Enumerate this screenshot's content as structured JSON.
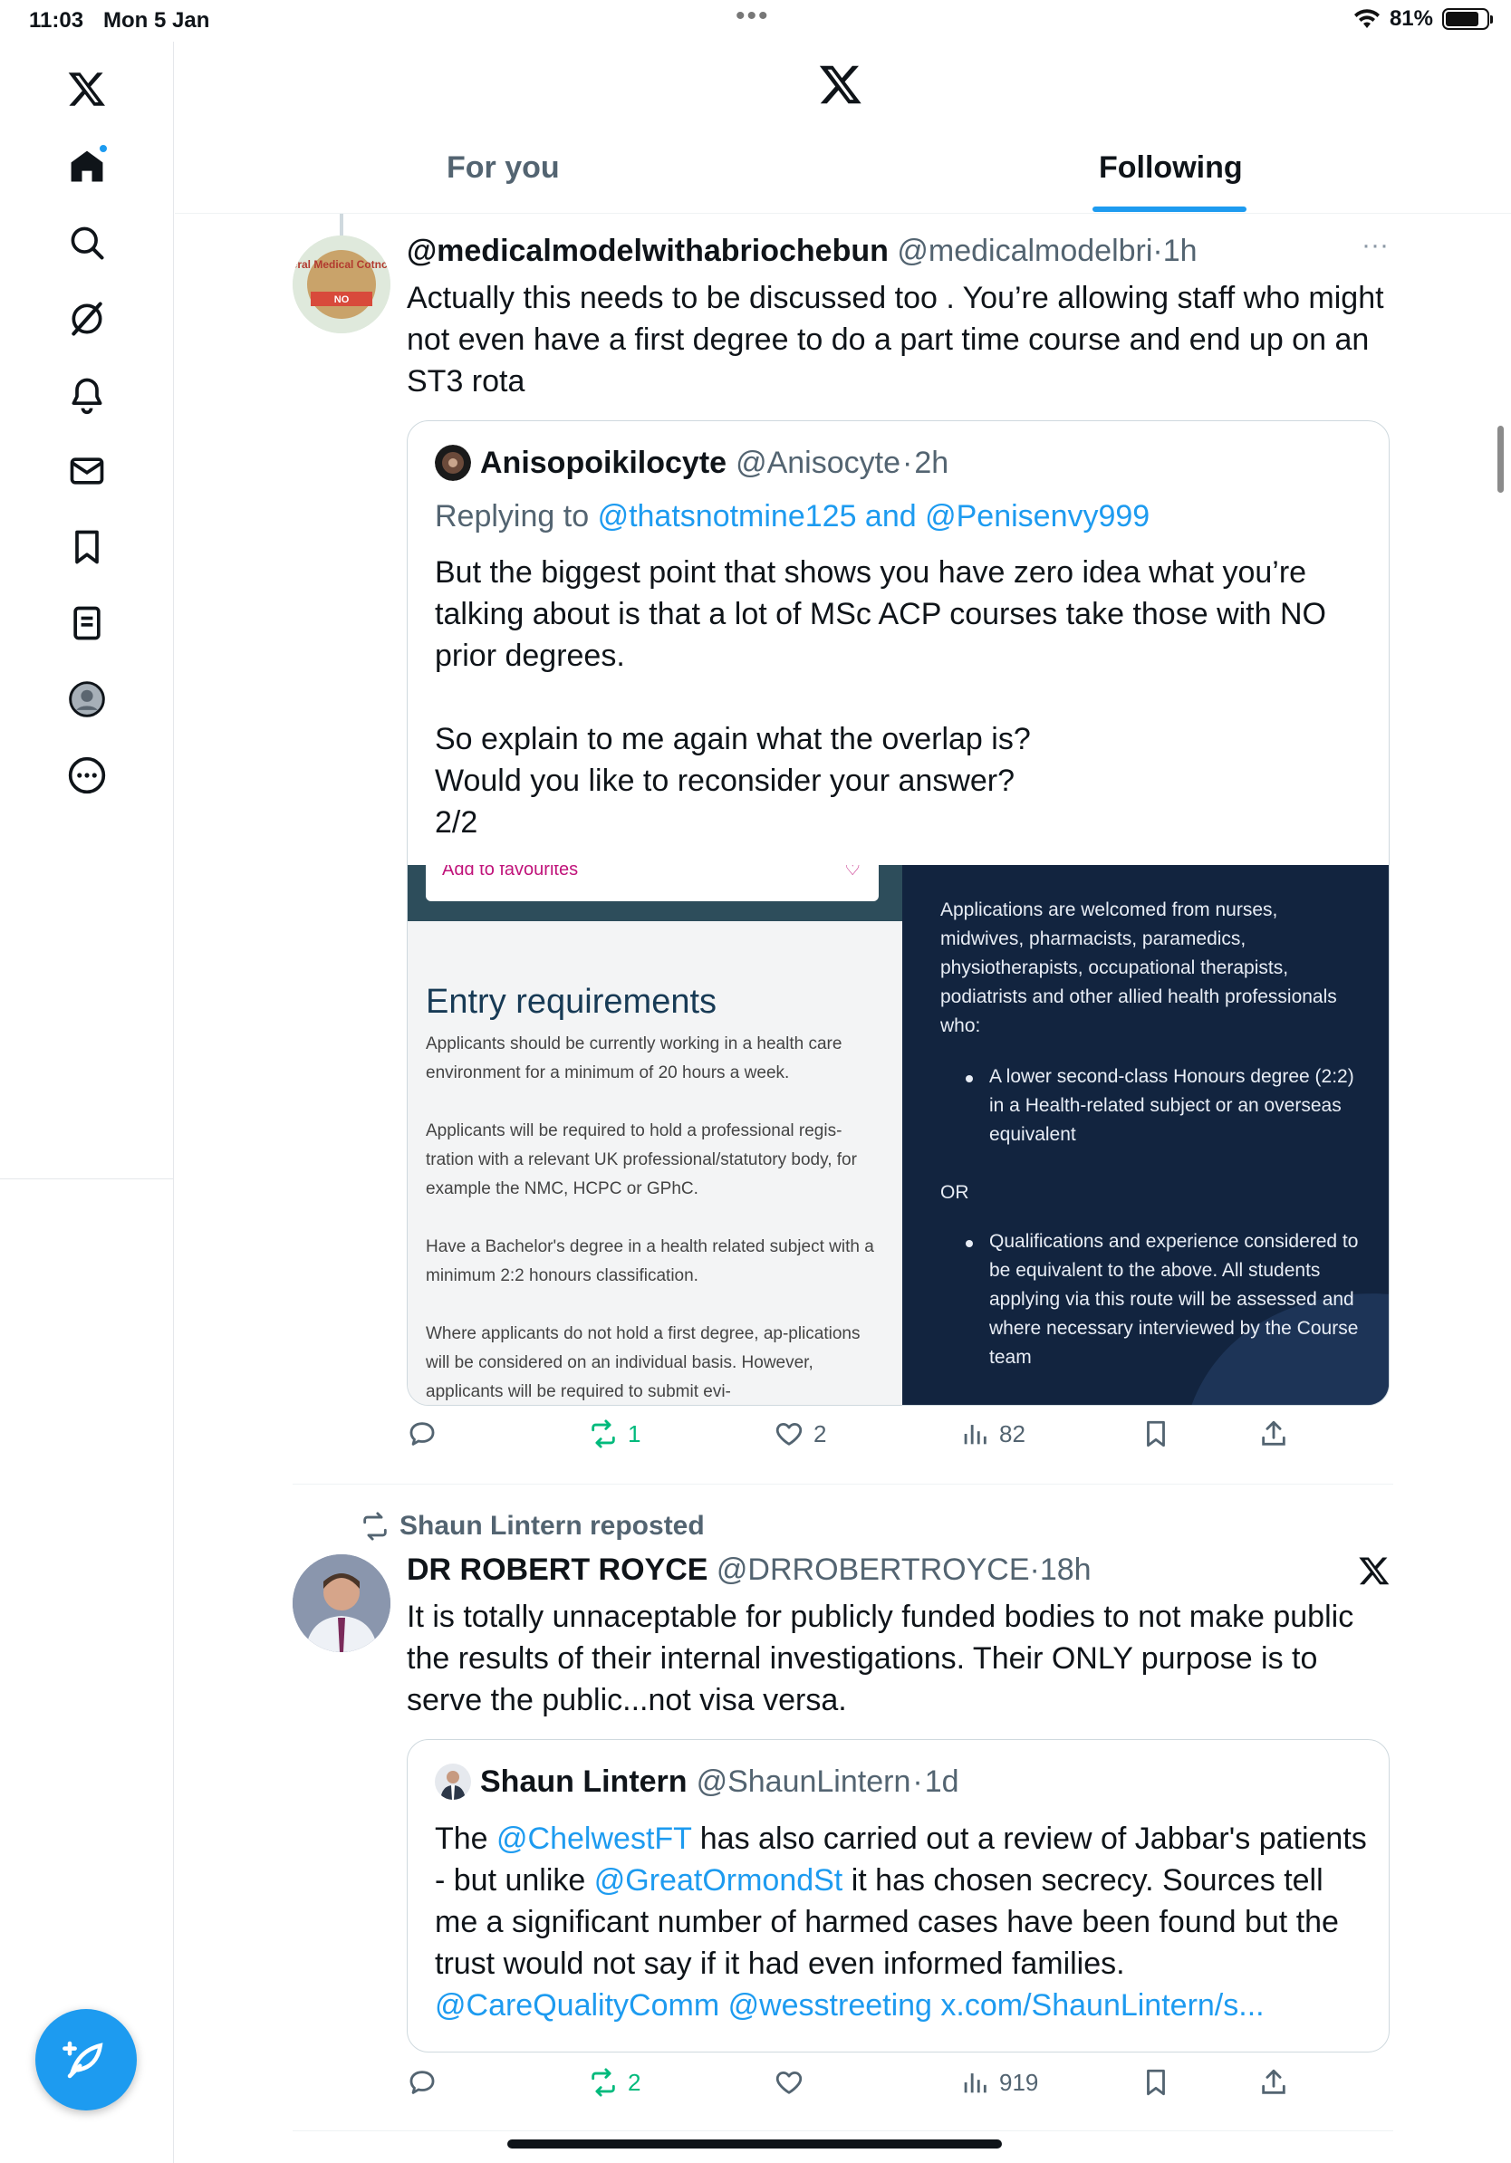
{
  "status_bar": {
    "time": "11:03",
    "date": "Mon 5 Jan",
    "battery": "81%",
    "battery_level": 0.81
  },
  "nav": {
    "items": [
      "x-logo",
      "home",
      "search",
      "grok",
      "notifications",
      "messages",
      "bookmarks",
      "lists",
      "profile",
      "more"
    ]
  },
  "header": {
    "tabs": [
      {
        "label": "For you"
      },
      {
        "label": "Following"
      }
    ],
    "active_tab": "Following"
  },
  "tweets": [
    {
      "name": "@medicalmodelwithabriochebun",
      "handle": "@medicalmodelbri",
      "time": "1h",
      "more": "···",
      "avatar_label": "General Medical Cotncil NO",
      "text": "Actually this needs to be discussed too . You’re allowing staff who might not even have a first degree to do a part time course and end up on an ST3 rota",
      "quote": {
        "name": "Anisopoikilocyte",
        "handle": "@Anisocyte",
        "time": "2h",
        "replying_prefix": "Replying to",
        "replying_to": "@thatsnotmine125 and @Penisenvy999",
        "text": "But the biggest point that shows you have zero idea what you’re talking about is that a lot of MSc ACP courses take those with NO prior degrees.\n\nSo explain to me again what the overlap is?\nWould you like to reconsider your answer?\n2/2",
        "image": {
          "left_fav": "Add to favourites",
          "left_title": "Entry requirements",
          "left_paragraphs": [
            "Applicants should be currently working in a health care environment for a minimum of 20 hours a week.",
            "Applicants will be required to hold a professional regis-tration with a relevant UK professional/statutory body, for example the NMC, HCPC or GPhC.",
            "Have a Bachelor's degree in a health related subject with a minimum 2:2 honours classification.",
            "Where applicants do not hold a first degree, ap-plications will be considered on an individual basis. However, applicants will be required to submit evi-"
          ],
          "right_intro": "Applications are welcomed from nurses, midwives, pharmacists, paramedics, physiotherapists, occupational therapists, podiatrists and other allied health professionals who:",
          "right_bullet1": "A lower second-class Honours degree (2:2) in a Health-related subject or an overseas equivalent",
          "right_or": "OR",
          "right_bullet2": "Qualifications and experience considered to be equivalent to the above. All students applying via this route will be assessed and where necessary interviewed by the Course team"
        }
      },
      "actions": {
        "replies": "",
        "reposts": "1",
        "likes": "2",
        "views": "82"
      }
    },
    {
      "repost_label": "Shaun Lintern reposted",
      "name": "DR ROBERT ROYCE",
      "handle": "@DRROBERTROYCE",
      "time": "18h",
      "text": "It is totally unnaceptable for publicly funded bodies  to not make public the results of their internal investigations. Their ONLY purpose is to serve the public...not visa versa.",
      "quote": {
        "name": "Shaun Lintern",
        "handle": "@ShaunLintern",
        "time": "1d",
        "text_parts": [
          {
            "t": "The ",
            "link": false
          },
          {
            "t": "@ChelwestFT",
            "link": true
          },
          {
            "t": " has also carried out a review of Jabbar's patients - but unlike ",
            "link": false
          },
          {
            "t": "@GreatOrmondSt",
            "link": true
          },
          {
            "t": " it has chosen secrecy. Sources tell me a significant number of harmed cases have been found but the trust would not say if it had even informed families. ",
            "link": false
          },
          {
            "t": "@CareQualityComm @wesstreeting x.com/ShaunLintern/s...",
            "link": true
          }
        ]
      },
      "actions": {
        "replies": "",
        "reposts": "2",
        "likes": "",
        "views": "919"
      }
    }
  ],
  "colors": {
    "accent": "#1d9bf0",
    "repost_green": "#00ba7c",
    "muted": "#536471",
    "text": "#0f1419"
  }
}
